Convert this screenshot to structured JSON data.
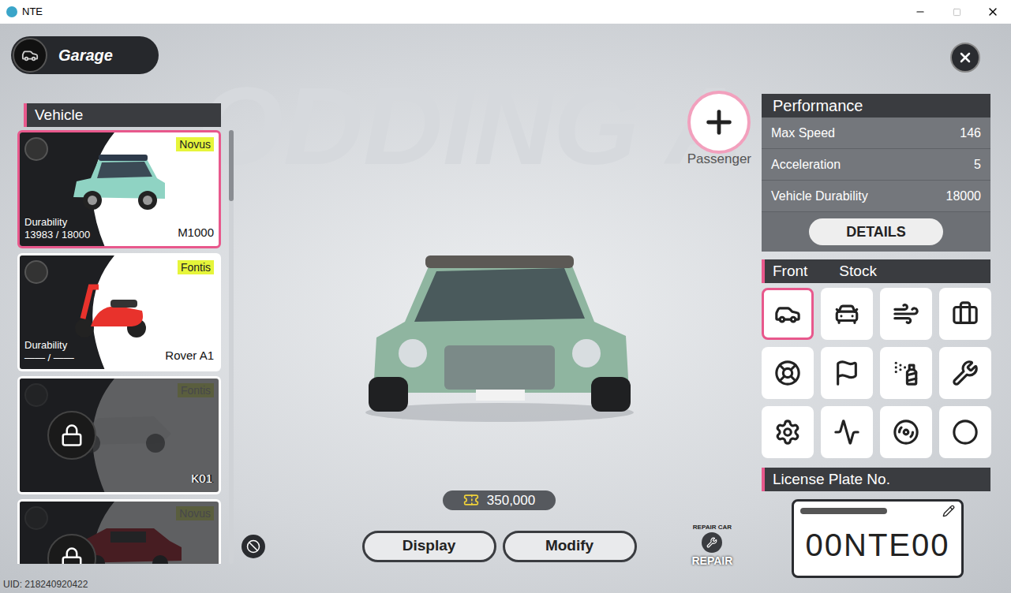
{
  "window": {
    "title": "NTE"
  },
  "header": {
    "title": "Garage"
  },
  "vehicle_list": {
    "title": "Vehicle",
    "items": [
      {
        "name": "M1000",
        "brand": "Novus",
        "kind": "car",
        "durability_label": "Durability",
        "durability": "13983 / 18000",
        "selected": true,
        "locked": false,
        "color": "#8fd3c3"
      },
      {
        "name": "Rover A1",
        "brand": "Fontis",
        "kind": "scooter",
        "durability_label": "Durability",
        "durability": "—— / ——",
        "selected": false,
        "locked": false,
        "color": "#e8322c"
      },
      {
        "name": "K01",
        "brand": "Fontis",
        "kind": "kart",
        "selected": false,
        "locked": true,
        "color": "#e8e8e8"
      },
      {
        "name": "",
        "brand": "Novus",
        "kind": "sedan",
        "selected": false,
        "locked": true,
        "color": "#b0202a"
      }
    ]
  },
  "background_text": "ODDING A",
  "passenger": {
    "label": "Passenger"
  },
  "performance": {
    "title": "Performance",
    "stats": [
      {
        "label": "Max Speed",
        "value": "146"
      },
      {
        "label": "Acceleration",
        "value": "5"
      },
      {
        "label": "Vehicle Durability",
        "value": "18000"
      }
    ],
    "details_button": "DETAILS"
  },
  "parts": {
    "slot": "Front",
    "variant": "Stock",
    "items": [
      {
        "kind": "front",
        "selected": true
      },
      {
        "kind": "rear",
        "selected": false
      },
      {
        "kind": "spoiler",
        "selected": false
      },
      {
        "kind": "kit",
        "selected": false
      },
      {
        "kind": "wheel",
        "selected": false
      },
      {
        "kind": "decal",
        "selected": false
      },
      {
        "kind": "paint",
        "selected": false
      },
      {
        "kind": "engine",
        "selected": false
      },
      {
        "kind": "gearbox",
        "selected": false
      },
      {
        "kind": "suspension",
        "selected": false
      },
      {
        "kind": "brake",
        "selected": false
      },
      {
        "kind": "tire",
        "selected": false
      }
    ]
  },
  "currency": {
    "amount": "350,000"
  },
  "buttons": [
    {
      "label": "Display"
    },
    {
      "label": "Modify"
    }
  ],
  "repair": {
    "label": "REPAIR",
    "arc_label": "REPAIR CAR"
  },
  "license_plate": {
    "title": "License Plate No.",
    "number": "00NTE00"
  },
  "uid": "UID: 218240920422"
}
